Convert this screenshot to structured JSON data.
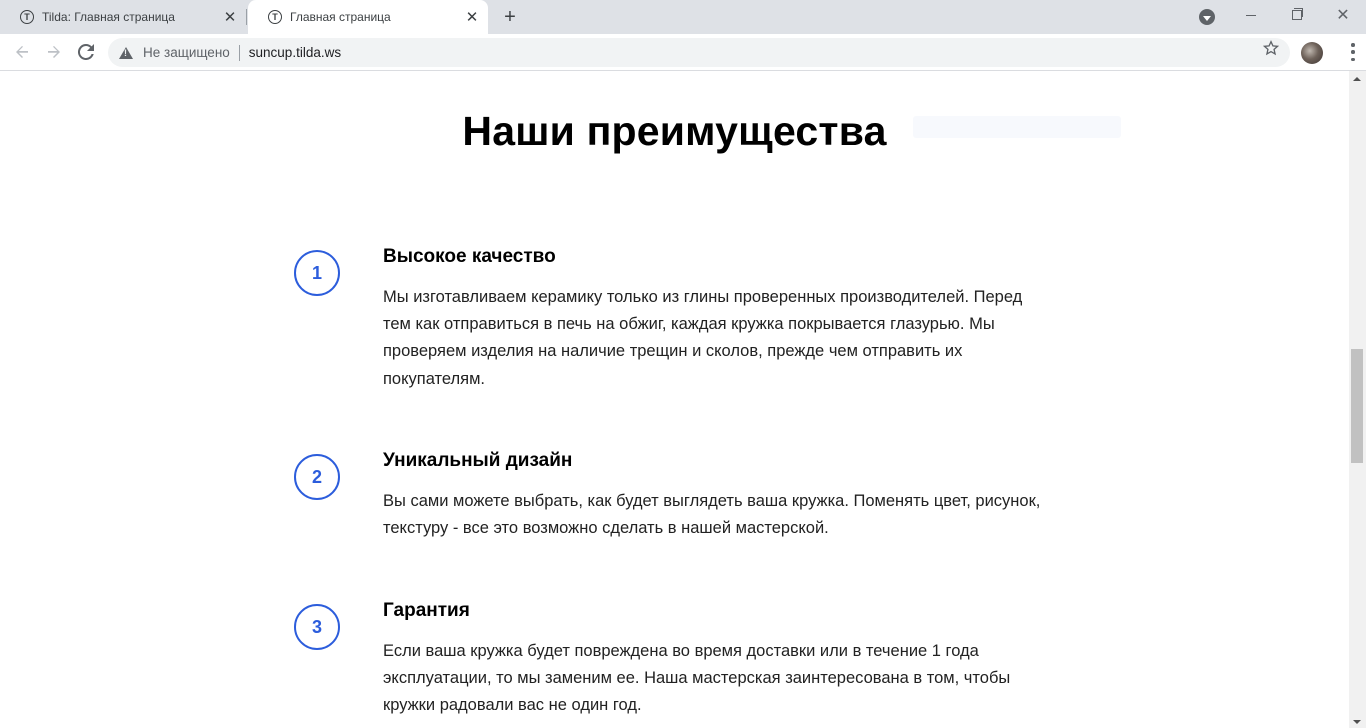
{
  "browser": {
    "tabs": [
      {
        "title": "Tilda: Главная страница",
        "active": false
      },
      {
        "title": "Главная страница",
        "active": true
      }
    ],
    "favicon_letter": "T",
    "close_glyph": "✕",
    "new_tab_glyph": "+",
    "security_label": "Не защищено",
    "url": "suncup.tilda.ws"
  },
  "page": {
    "heading": "Наши преимущества",
    "accent_color": "#2c5ddc",
    "items": [
      {
        "number": "1",
        "title": "Высокое качество",
        "text": "Мы изготавливаем керамику только из глины проверенных производителей. Перед тем как отправиться в печь на обжиг, каждая кружка покрывается глазурью. Мы проверяем изделия на наличие трещин и сколов, прежде чем отправить их покупателям."
      },
      {
        "number": "2",
        "title": "Уникальный дизайн",
        "text": "Вы сами можете выбрать, как будет выглядеть ваша кружка. Поменять цвет, рисунок, текстуру - все это возможно сделать в нашей мастерской."
      },
      {
        "number": "3",
        "title": "Гарантия",
        "text": "Если ваша кружка будет повреждена во время доставки или в течение 1 года эксплуатации, то мы заменим ее. Наша мастерская заинтересована в том, чтобы кружки радовали вас не один год."
      }
    ]
  },
  "icons": {
    "back": "arrow-left-icon",
    "forward": "arrow-right-icon",
    "reload": "reload-icon",
    "warning": "warning-triangle-icon",
    "bookmark": "star-icon",
    "menu": "kebab-menu-icon"
  }
}
